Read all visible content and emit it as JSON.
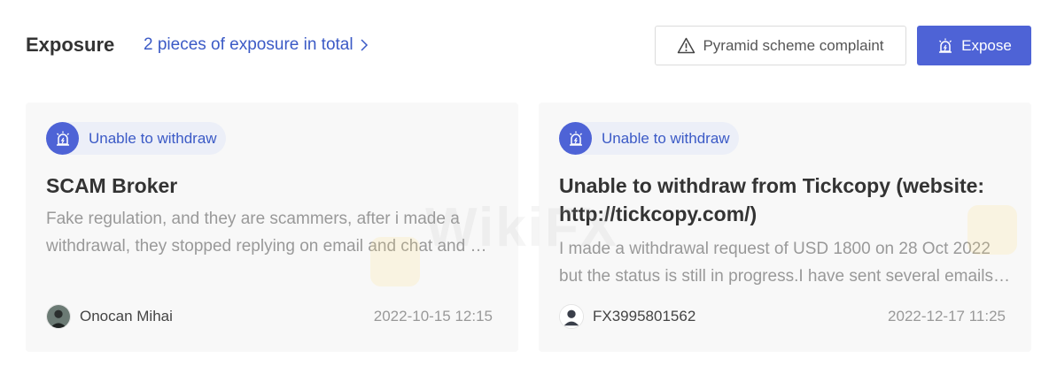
{
  "header": {
    "title": "Exposure",
    "total_link": "2 pieces of exposure in total",
    "complaint_button": "Pyramid scheme complaint",
    "expose_button": "Expose"
  },
  "colors": {
    "accent": "#4e63d6",
    "link": "#3b5ac6",
    "card_bg": "#f8f8f8"
  },
  "cards": [
    {
      "tag": "Unable to withdraw",
      "title": "SCAM Broker",
      "description": "Fake regulation, and they are scammers, after i made a withdrawal, they stopped replying on email and chat and my account has been blocked.",
      "author": "Onocan Mihai",
      "date": "2022-10-15 12:15"
    },
    {
      "tag": "Unable to withdraw",
      "title": "Unable to withdraw from Tickcopy (website: http://tickcopy.com/)",
      "description": "I made a withdrawal request of USD 1800 on 28 Oct 2022 but the status is still in progress.I have sent several emails but no response at all.",
      "author": "FX3995801562",
      "date": "2022-12-17 11:25"
    }
  ],
  "watermark": {
    "text": "WikiFX"
  }
}
